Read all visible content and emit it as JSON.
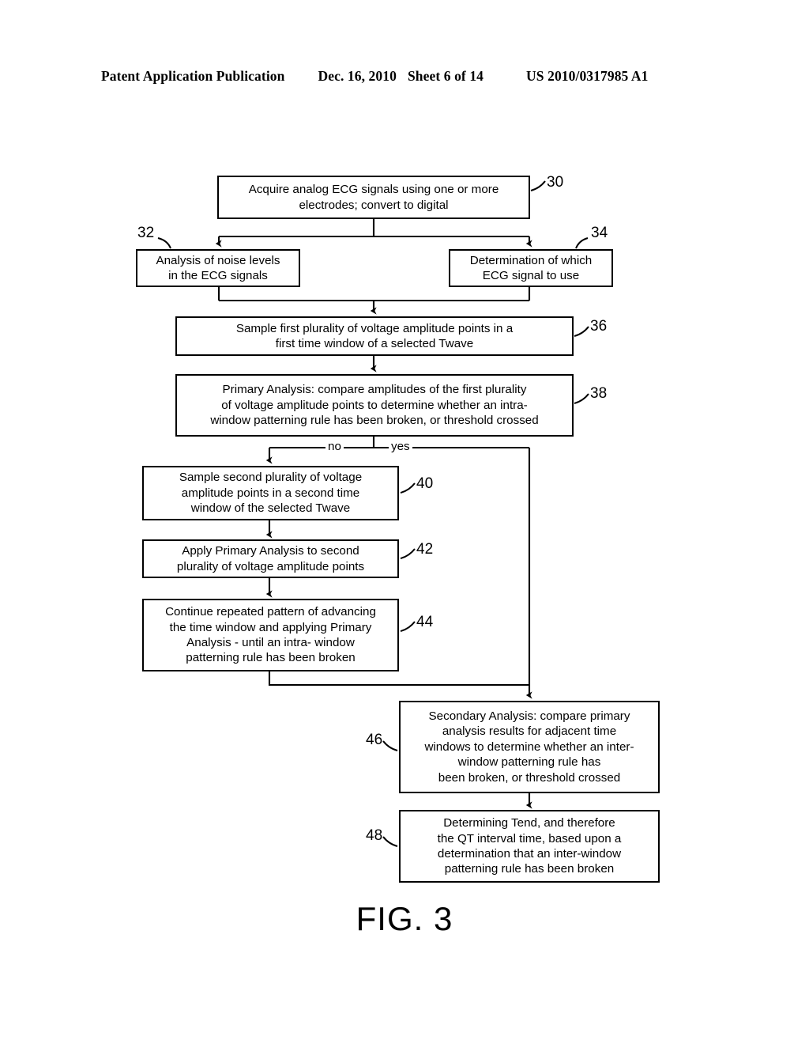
{
  "header": {
    "publication": "Patent Application Publication",
    "date": "Dec. 16, 2010",
    "sheet": "Sheet 6 of 14",
    "patent_number": "US 2010/0317985 A1"
  },
  "figure": {
    "caption": "FIG. 3",
    "diagram_type": "flowchart"
  },
  "nodes": {
    "n30": {
      "ref": "30",
      "line1": "Acquire analog ECG signals using one or more",
      "line2": "electrodes; convert to digital"
    },
    "n32": {
      "ref": "32",
      "line1": "Analysis of noise levels",
      "line2": "in the ECG signals"
    },
    "n34": {
      "ref": "34",
      "line1": "Determination of which",
      "line2": "ECG signal to use"
    },
    "n36": {
      "ref": "36",
      "line1": "Sample first plurality of voltage amplitude points in a",
      "line2": "first time window of a selected Twave"
    },
    "n38": {
      "ref": "38",
      "line1": "Primary Analysis: compare amplitudes of the first plurality",
      "line2": "of voltage amplitude points to determine whether an intra-",
      "line3": "window patterning rule has been broken, or threshold crossed"
    },
    "n40": {
      "ref": "40",
      "line1": "Sample second plurality of voltage",
      "line2": "amplitude points in a second time",
      "line3": "window of the selected Twave"
    },
    "n42": {
      "ref": "42",
      "line1": "Apply Primary Analysis to second",
      "line2": "plurality of voltage amplitude points"
    },
    "n44": {
      "ref": "44",
      "line1": "Continue repeated pattern of advancing",
      "line2": "the time window and applying Primary",
      "line3": "Analysis - until an intra- window",
      "line4": "patterning rule has been broken"
    },
    "n46": {
      "ref": "46",
      "line1": "Secondary Analysis: compare primary",
      "line2": "analysis results for adjacent time",
      "line3": "windows to determine whether an inter-",
      "line4": "window patterning rule has",
      "line5": "been broken, or threshold crossed"
    },
    "n48": {
      "ref": "48",
      "line1": "Determining Tend, and therefore",
      "line2": "the QT interval time, based upon a",
      "line3": "determination that an inter-window",
      "line4": "patterning rule has been broken"
    }
  },
  "branches": {
    "no": "no",
    "yes": "yes"
  },
  "colors": {
    "ink": "#000000",
    "paper": "#ffffff"
  }
}
